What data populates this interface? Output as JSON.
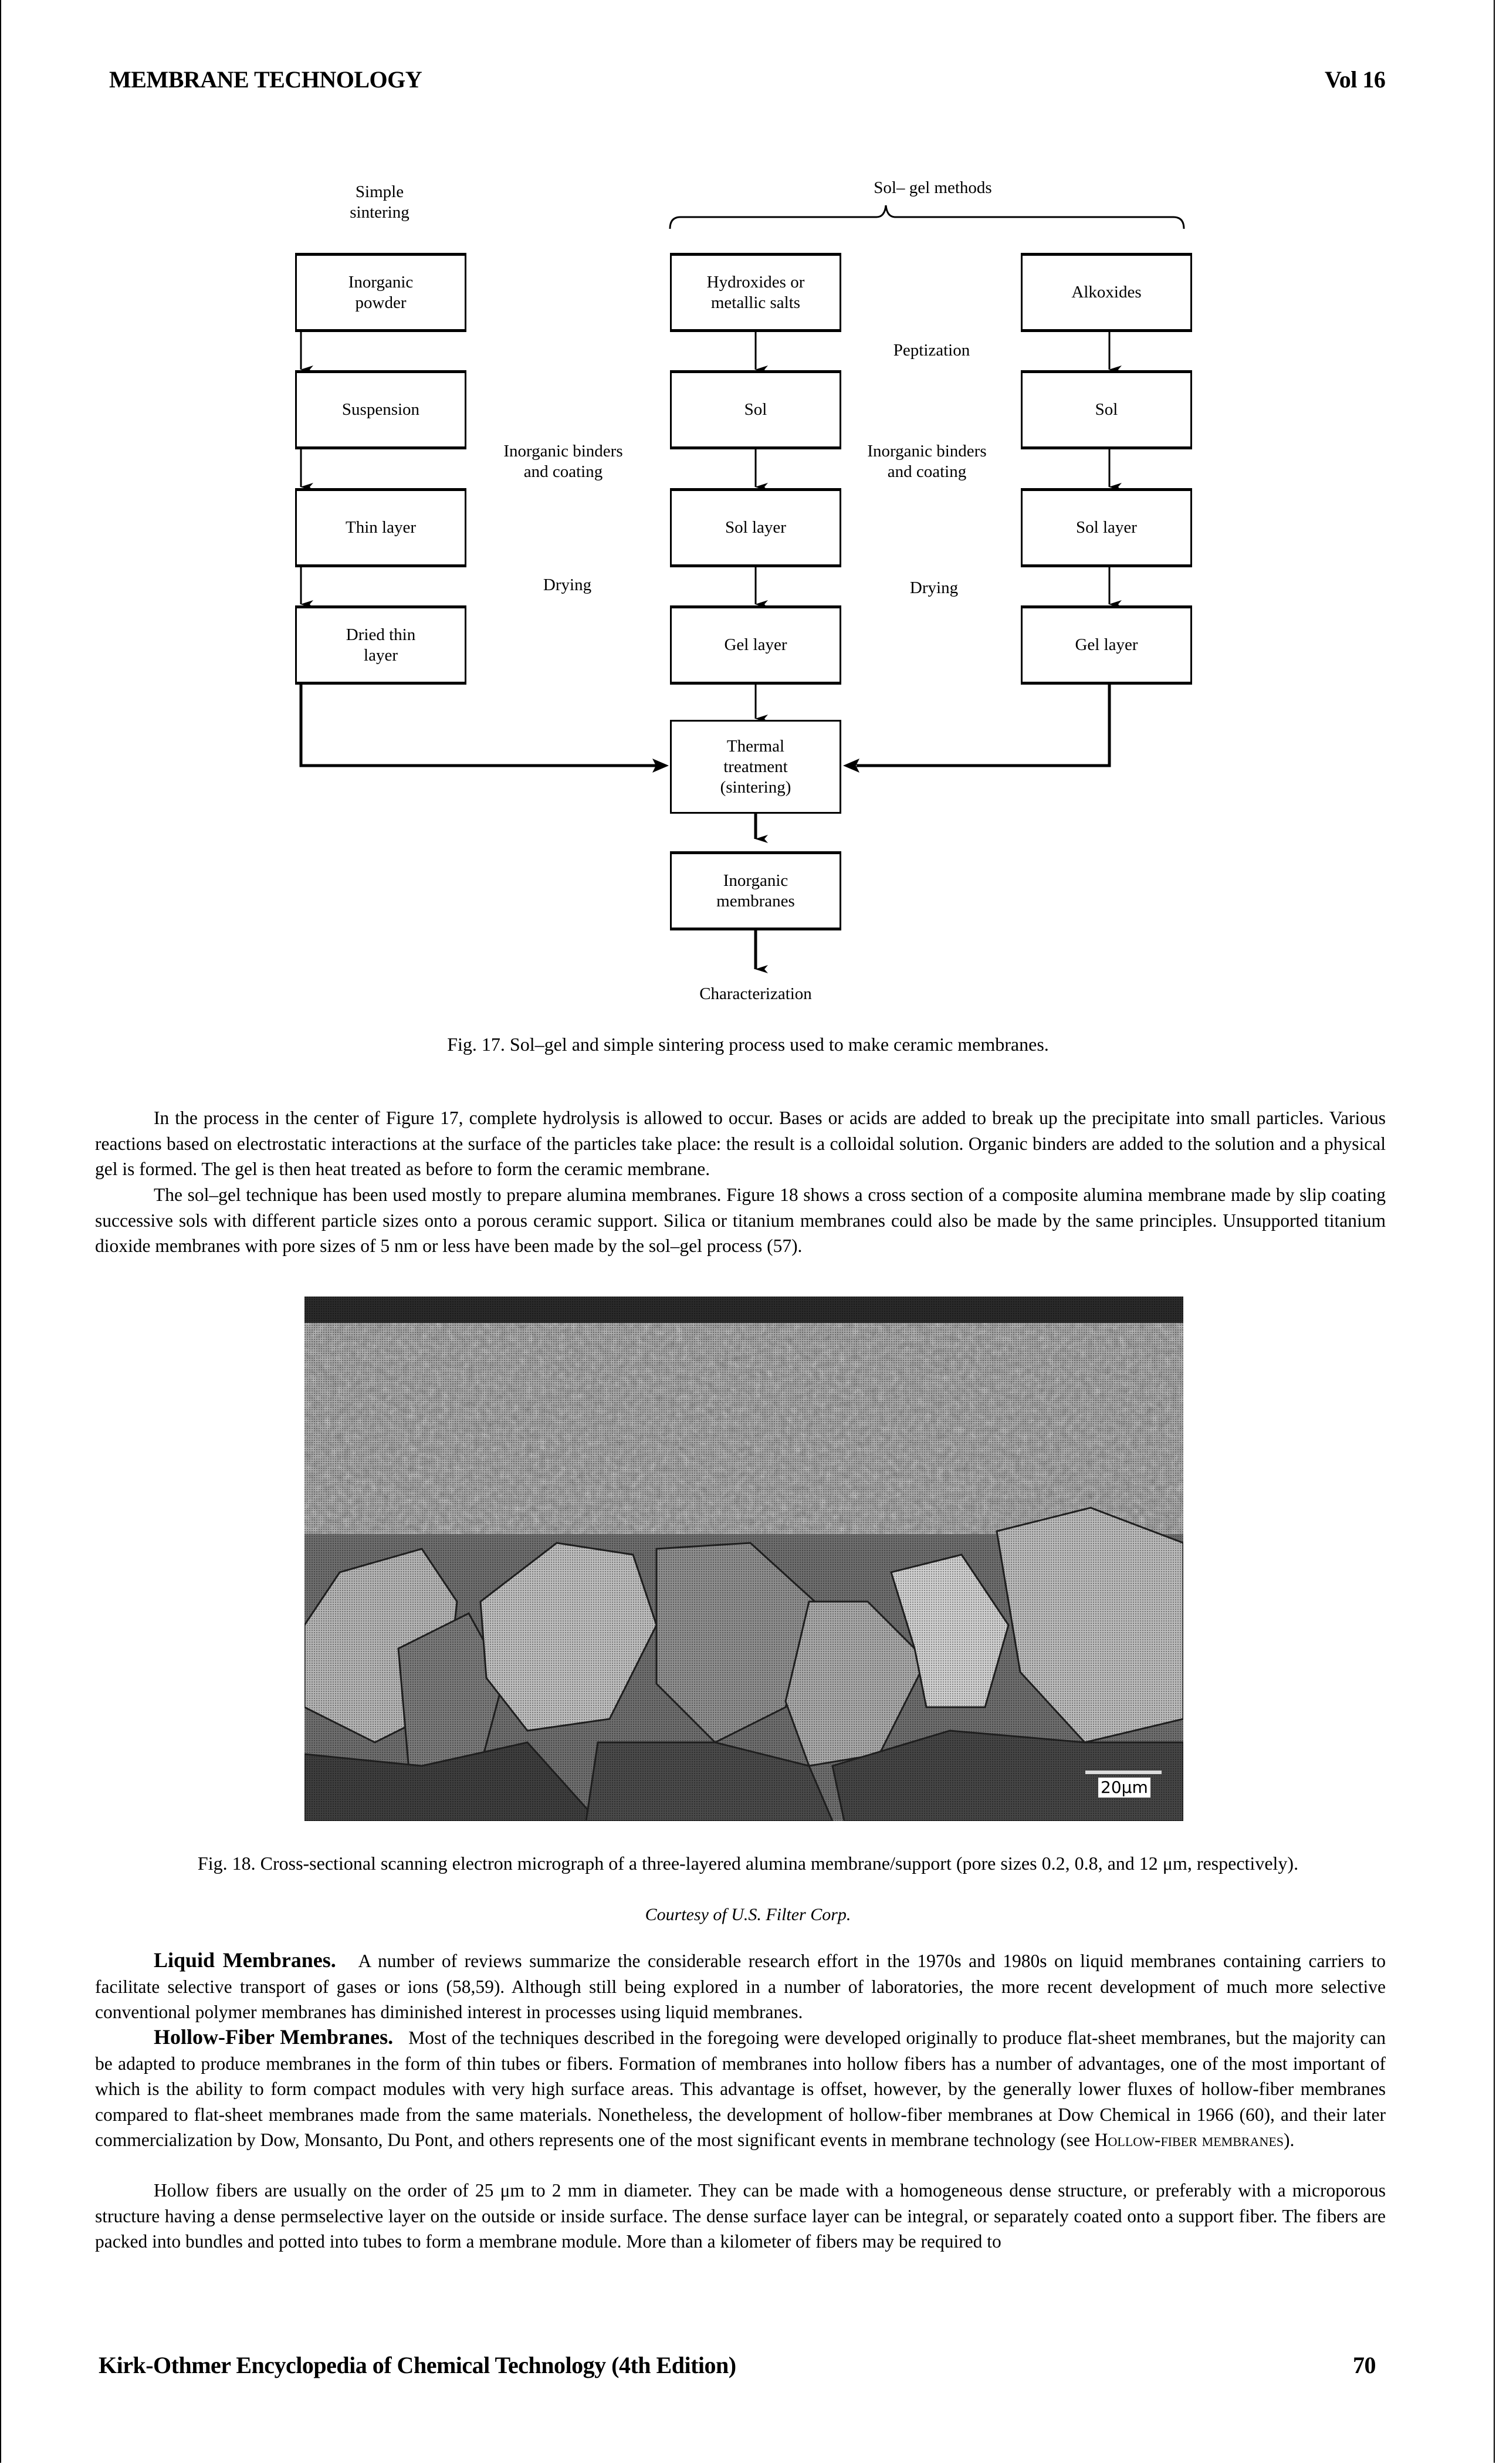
{
  "header": {
    "left": "MEMBRANE TECHNOLOGY",
    "right": "Vol 16"
  },
  "figure17": {
    "col_title_left": "Simple\nsintering",
    "col_title_right": "Sol– gel methods",
    "left_column": [
      "Inorganic\npowder",
      "Suspension",
      "Thin layer",
      "Dried thin\nlayer"
    ],
    "center_column": [
      "Hydroxides or\nmetallic salts",
      "Sol",
      "Sol layer",
      "Gel layer"
    ],
    "right_column": [
      "Alkoxides",
      "Sol",
      "Sol layer",
      "Gel layer"
    ],
    "step_labels_left": [
      "Inorganic binders\nand coating",
      "Drying"
    ],
    "step_labels_right": [
      "Peptization",
      "Inorganic binders\nand coating",
      "Drying"
    ],
    "thermal_box": "Thermal\ntreatment\n(sintering)",
    "membranes_box": "Inorganic\nmembranes",
    "final_label": "Characterization",
    "caption": "Fig. 17. Sol–gel and simple sintering process used to make ceramic membranes."
  },
  "paragraphs_top": [
    "In the process in the center of Figure 17, complete hydrolysis is allowed to occur. Bases or acids are added to break up the precipitate into small particles. Various reactions based on electrostatic interactions at the surface of the particles take place: the result is a colloidal solution. Organic binders are added to the solution and a physical gel is formed. The gel is then heat treated as before to form the ceramic membrane.",
    "The sol–gel technique has been used mostly to prepare alumina membranes. Figure 18 shows a cross section of a composite alumina membrane made by slip coating successive sols with different particle sizes onto a porous ceramic support. Silica or titanium membranes could also be made by the same principles. Unsupported titanium dioxide membranes with pore sizes of 5 nm or less have been made by the sol–gel process (57)."
  ],
  "figure18": {
    "scale_label": "20μm",
    "caption": "Fig. 18. Cross-sectional scanning electron micrograph of a three-layered alumina membrane/support (pore sizes 0.2, 0.8, and 12 μm, respectively).",
    "credit": "Courtesy of U.S. Filter Corp."
  },
  "liquid_section": {
    "heading": "Liquid Membranes.",
    "text": "A number of reviews summarize the considerable research effort in the 1970s and 1980s on liquid membranes containing carriers to facilitate selective transport of gases or ions (58,59). Although still being explored in a number of laboratories, the more recent development of much more selective conventional polymer membranes has diminished interest in processes using liquid membranes."
  },
  "hollow_section": {
    "heading": "Hollow-Fiber Membranes.",
    "text": "Most of the techniques described in the foregoing were developed originally to produce flat-sheet membranes, but the majority can be adapted to produce membranes in the form of thin tubes or fibers. Formation of membranes into hollow fibers has a number of advantages, one of the most important of which is the ability to form compact modules with very high surface areas. This advantage is offset, however, by the generally lower fluxes of hollow-fiber membranes compared to flat-sheet membranes made from the same materials. Nonetheless, the development of hollow-fiber membranes at Dow Chemical in 1966 (60), and their later commercialization by Dow, Monsanto, Du Pont, and others represents one of the most significant events in membrane technology (see ",
    "xref": "Hollow-fiber membranes",
    "text_end": ").",
    "next_paragraph": "Hollow fibers are usually on the order of 25 μm to 2 mm in diameter. They can be made with a homogeneous dense structure, or preferably with a microporous structure having a dense permselective layer on the outside or inside surface. The dense surface layer can be integral, or separately coated onto a support fiber. The fibers are packed into bundles and potted into tubes to form a membrane module. More than a kilometer of fibers may be required to"
  },
  "footer": {
    "left": "Kirk-Othmer Encyclopedia of Chemical Technology (4th Edition)",
    "right": "70"
  }
}
